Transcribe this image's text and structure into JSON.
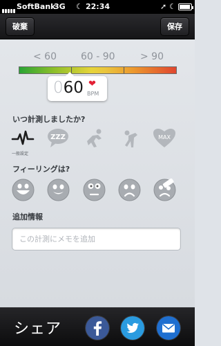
{
  "status_bar": {
    "carrier": "SoftBank",
    "network": "3G",
    "time": "22:34",
    "icons": [
      "signal-icon",
      "moon-icon",
      "location-arrow-icon",
      "battery-icon"
    ]
  },
  "nav": {
    "left_button": "破棄",
    "right_button": "保存"
  },
  "heart_rate": {
    "ranges": [
      "< 60",
      "60 - 90",
      "> 90"
    ],
    "value_dim": "0",
    "value": "60",
    "unit": "BPM",
    "heart_icon": "heart-icon",
    "gauge_colors": [
      "#2aa435",
      "#e6d43a",
      "#e0462f"
    ]
  },
  "activity": {
    "title": "いつ計測しましたか?",
    "selected_label": "一般設定",
    "options": [
      {
        "icon": "heartbeat-icon",
        "selected": true
      },
      {
        "icon": "sleep-zzz-icon",
        "selected": false
      },
      {
        "icon": "runner-start-icon",
        "selected": false
      },
      {
        "icon": "exhausted-person-icon",
        "selected": false
      },
      {
        "icon": "max-heart-icon",
        "text": "MAX",
        "selected": false
      }
    ]
  },
  "feeling": {
    "title": "フィーリングは?",
    "options": [
      {
        "icon": "grin-face-icon"
      },
      {
        "icon": "smile-face-icon"
      },
      {
        "icon": "neutral-face-icon"
      },
      {
        "icon": "sad-face-icon"
      },
      {
        "icon": "injured-face-icon"
      }
    ]
  },
  "memo": {
    "title": "追加情報",
    "placeholder": "この計測にメモを追加"
  },
  "share": {
    "label": "シェア",
    "buttons": [
      {
        "icon": "facebook-icon",
        "color": "#3b5998"
      },
      {
        "icon": "twitter-icon",
        "color": "#2a9be0"
      },
      {
        "icon": "mail-icon",
        "color": "#1f6fd0"
      }
    ]
  }
}
